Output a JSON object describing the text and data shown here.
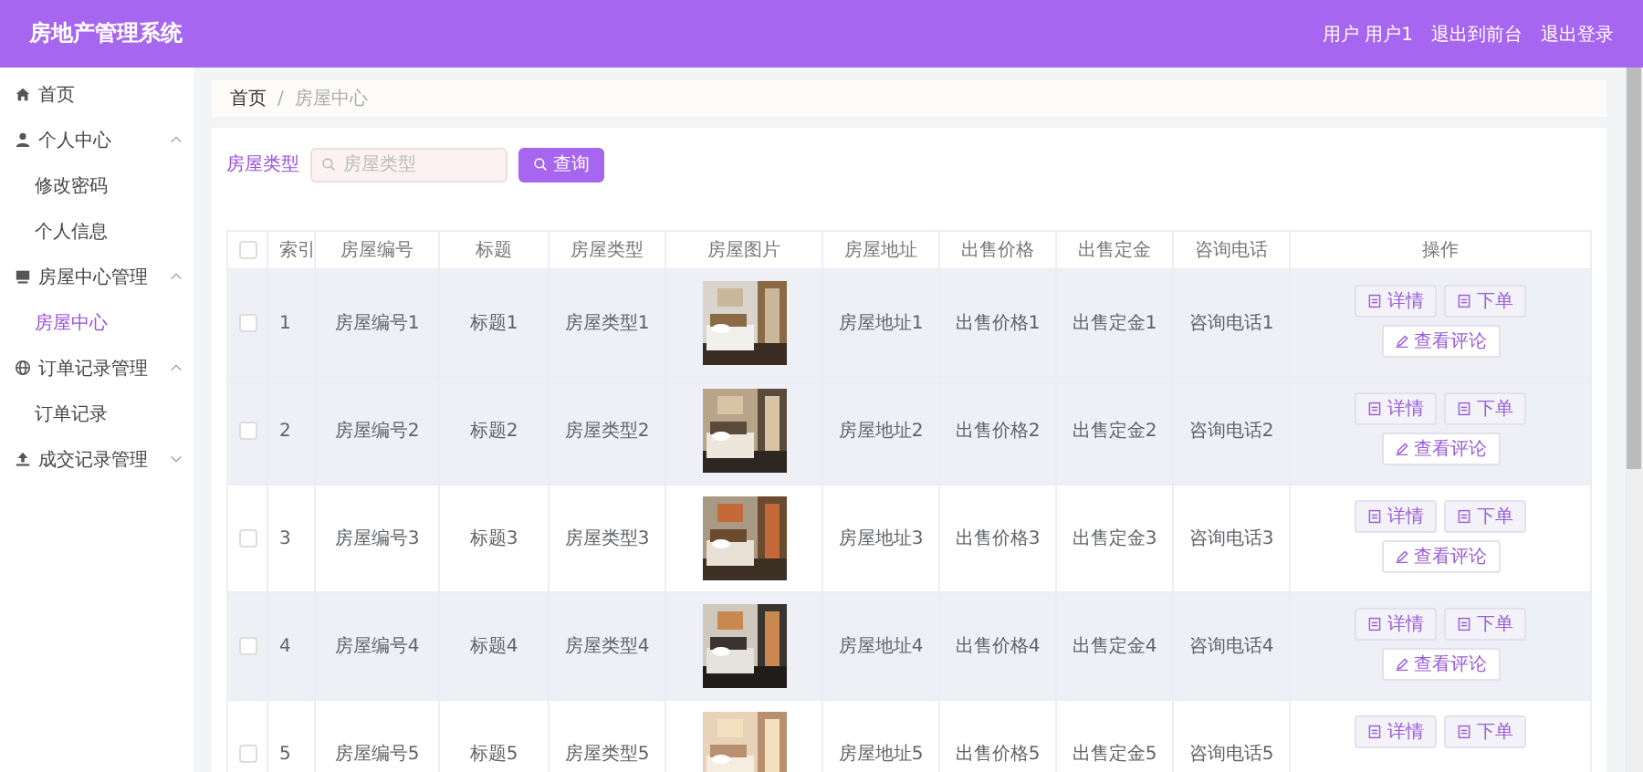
{
  "header": {
    "title": "房地产管理系统",
    "links": [
      {
        "label": "用户 用户1"
      },
      {
        "label": "退出到前台"
      },
      {
        "label": "退出登录"
      }
    ]
  },
  "sidebar": {
    "items": [
      {
        "label": "首页",
        "selected": false
      },
      {
        "label": "个人中心",
        "expanded": true,
        "selected": false,
        "children": [
          {
            "label": "修改密码",
            "selected": false
          },
          {
            "label": "个人信息",
            "selected": false
          }
        ]
      },
      {
        "label": "房屋中心管理",
        "expanded": true,
        "selected": false,
        "children": [
          {
            "label": "房屋中心",
            "selected": true
          }
        ]
      },
      {
        "label": "订单记录管理",
        "expanded": true,
        "selected": false,
        "children": [
          {
            "label": "订单记录",
            "selected": false
          }
        ]
      },
      {
        "label": "成交记录管理",
        "expanded": false,
        "selected": false
      }
    ]
  },
  "breadcrumb": {
    "separator": "/",
    "items": [
      {
        "label": "首页"
      },
      {
        "label": "房屋中心"
      }
    ]
  },
  "search": {
    "label": "房屋类型",
    "placeholder": "房屋类型",
    "button": "查询"
  },
  "table": {
    "select_all": {
      "checked": false
    },
    "columns": [
      "索引",
      "房屋编号",
      "标题",
      "房屋类型",
      "房屋图片",
      "房屋地址",
      "出售价格",
      "出售定金",
      "咨询电话",
      "操作"
    ],
    "rows": [
      {
        "checked": false,
        "shaded": true,
        "cells": [
          {
            "kind": "text",
            "text": "1"
          },
          {
            "kind": "text",
            "text": "房屋编号1"
          },
          {
            "kind": "text",
            "text": "标题1"
          },
          {
            "kind": "text",
            "text": "房屋类型1"
          },
          {
            "kind": "picture"
          },
          {
            "kind": "text",
            "text": "房屋地址1"
          },
          {
            "kind": "text",
            "text": "出售价格1"
          },
          {
            "kind": "text",
            "text": "出售定金1"
          },
          {
            "kind": "text",
            "text": "咨询电话1"
          },
          {
            "kind": "actions",
            "buttons": [
              {
                "kind": "detail",
                "label": "详情"
              },
              {
                "kind": "order",
                "label": "下单"
              },
              {
                "kind": "review",
                "label": "查看评论"
              }
            ]
          }
        ]
      },
      {
        "checked": false,
        "shaded": true,
        "cells": [
          {
            "kind": "text",
            "text": "2"
          },
          {
            "kind": "text",
            "text": "房屋编号2"
          },
          {
            "kind": "text",
            "text": "标题2"
          },
          {
            "kind": "text",
            "text": "房屋类型2"
          },
          {
            "kind": "picture"
          },
          {
            "kind": "text",
            "text": "房屋地址2"
          },
          {
            "kind": "text",
            "text": "出售价格2"
          },
          {
            "kind": "text",
            "text": "出售定金2"
          },
          {
            "kind": "text",
            "text": "咨询电话2"
          },
          {
            "kind": "actions",
            "buttons": [
              {
                "kind": "detail",
                "label": "详情"
              },
              {
                "kind": "order",
                "label": "下单"
              },
              {
                "kind": "review",
                "label": "查看评论"
              }
            ]
          }
        ]
      },
      {
        "checked": false,
        "shaded": false,
        "cells": [
          {
            "kind": "text",
            "text": "3"
          },
          {
            "kind": "text",
            "text": "房屋编号3"
          },
          {
            "kind": "text",
            "text": "标题3"
          },
          {
            "kind": "text",
            "text": "房屋类型3"
          },
          {
            "kind": "picture"
          },
          {
            "kind": "text",
            "text": "房屋地址3"
          },
          {
            "kind": "text",
            "text": "出售价格3"
          },
          {
            "kind": "text",
            "text": "出售定金3"
          },
          {
            "kind": "text",
            "text": "咨询电话3"
          },
          {
            "kind": "actions",
            "buttons": [
              {
                "kind": "detail",
                "label": "详情"
              },
              {
                "kind": "order",
                "label": "下单"
              },
              {
                "kind": "review",
                "label": "查看评论"
              }
            ]
          }
        ]
      },
      {
        "checked": false,
        "shaded": true,
        "cells": [
          {
            "kind": "text",
            "text": "4"
          },
          {
            "kind": "text",
            "text": "房屋编号4"
          },
          {
            "kind": "text",
            "text": "标题4"
          },
          {
            "kind": "text",
            "text": "房屋类型4"
          },
          {
            "kind": "picture"
          },
          {
            "kind": "text",
            "text": "房屋地址4"
          },
          {
            "kind": "text",
            "text": "出售价格4"
          },
          {
            "kind": "text",
            "text": "出售定金4"
          },
          {
            "kind": "text",
            "text": "咨询电话4"
          },
          {
            "kind": "actions",
            "buttons": [
              {
                "kind": "detail",
                "label": "详情"
              },
              {
                "kind": "order",
                "label": "下单"
              },
              {
                "kind": "review",
                "label": "查看评论"
              }
            ]
          }
        ]
      },
      {
        "checked": false,
        "shaded": false,
        "cells": [
          {
            "kind": "text",
            "text": "5"
          },
          {
            "kind": "text",
            "text": "房屋编号5"
          },
          {
            "kind": "text",
            "text": "标题5"
          },
          {
            "kind": "text",
            "text": "房屋类型5"
          },
          {
            "kind": "picture"
          },
          {
            "kind": "text",
            "text": "房屋地址5"
          },
          {
            "kind": "text",
            "text": "出售价格5"
          },
          {
            "kind": "text",
            "text": "出售定金5"
          },
          {
            "kind": "text",
            "text": "咨询电话5"
          },
          {
            "kind": "actions",
            "buttons": [
              {
                "kind": "detail",
                "label": "详情"
              },
              {
                "kind": "order",
                "label": "下单"
              }
            ]
          }
        ]
      }
    ]
  }
}
